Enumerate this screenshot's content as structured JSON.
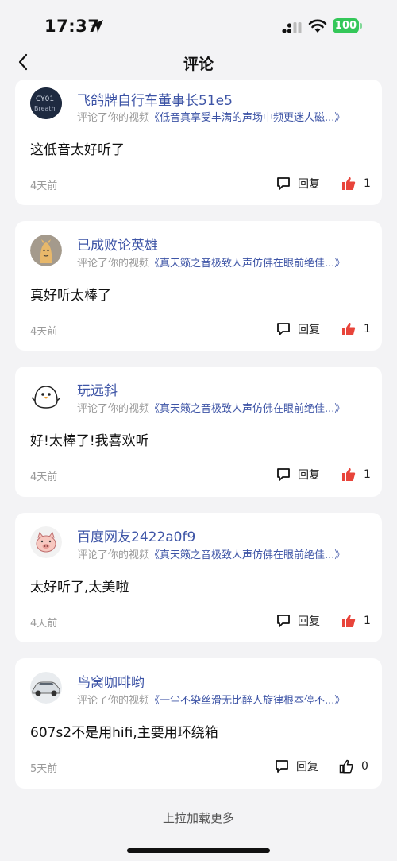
{
  "status_bar": {
    "time": "17:37",
    "battery": "100"
  },
  "nav": {
    "title": "评论",
    "back_icon": "chevron-left-icon"
  },
  "comments": [
    {
      "username": "飞鸽牌自行车董事长51e5",
      "action": "评论了你的视频",
      "video_title": "《低音真享受丰满的声场中频更迷人磁...》",
      "text": "这低音太好听了",
      "time_ago": "4天前",
      "reply_label": "回复",
      "likes": "1",
      "liked": true
    },
    {
      "username": "已成败论英雄",
      "action": "评论了你的视频",
      "video_title": "《真天籁之音极致人声仿佛在眼前绝佳...》",
      "text": "真好听太棒了",
      "time_ago": "4天前",
      "reply_label": "回复",
      "likes": "1",
      "liked": true
    },
    {
      "username": "玩远斜",
      "action": "评论了你的视频",
      "video_title": "《真天籁之音极致人声仿佛在眼前绝佳...》",
      "text": "好!太棒了!我喜欢听",
      "time_ago": "4天前",
      "reply_label": "回复",
      "likes": "1",
      "liked": true
    },
    {
      "username": "百度网友2422a0f9",
      "action": "评论了你的视频",
      "video_title": "《真天籁之音极致人声仿佛在眼前绝佳...》",
      "text": "太好听了,太美啦",
      "time_ago": "4天前",
      "reply_label": "回复",
      "likes": "1",
      "liked": true
    },
    {
      "username": "鸟窝咖啡哟",
      "action": "评论了你的视频",
      "video_title": "《一尘不染丝滑无比醉人旋律根本停不...》",
      "text": "607s2不是用hifi,主要用环绕箱",
      "time_ago": "5天前",
      "reply_label": "回复",
      "likes": "0",
      "liked": false
    }
  ],
  "footer": {
    "load_more": "上拉加载更多"
  },
  "colors": {
    "link": "#3d54a6",
    "liked": "#e8443a",
    "muted": "#9a9a9a"
  }
}
